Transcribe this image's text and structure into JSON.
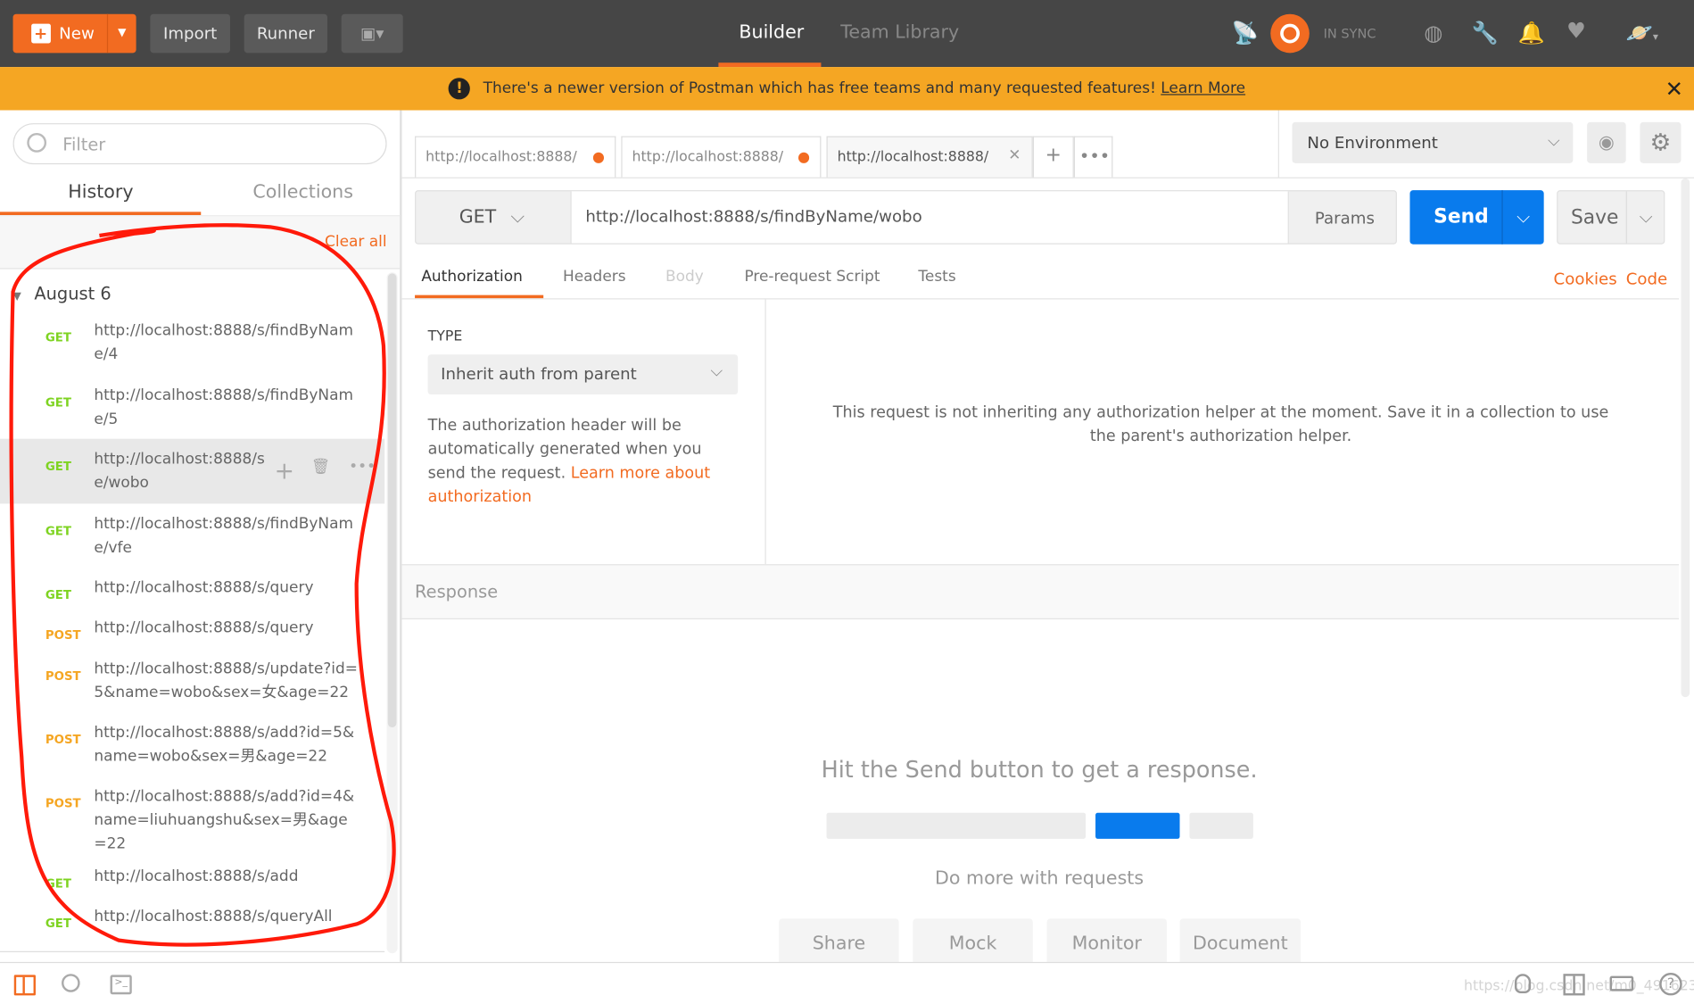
{
  "topbar": {
    "new_label": "New",
    "import_label": "Import",
    "runner_label": "Runner",
    "tabs": [
      "Builder",
      "Team Library"
    ],
    "active_tab": "Builder",
    "sync_status": "IN SYNC",
    "accent": "#f26b21"
  },
  "banner": {
    "message": "There's a newer version of Postman which has free teams and many requested features!",
    "link": "Learn More",
    "color": "#f5a623"
  },
  "sidebar": {
    "filter_placeholder": "Filter",
    "tabs": [
      "History",
      "Collections"
    ],
    "active_tab": "History",
    "clear_all": "Clear all",
    "group": "August 6",
    "items": [
      {
        "method": "GET",
        "url": "http://localhost:8888/s/findByName/4"
      },
      {
        "method": "GET",
        "url": "http://localhost:8888/s/findByName/5"
      },
      {
        "method": "GET",
        "url": "http://localhost:8888/s/findByName/wobo",
        "display": "http://localhost:8888/s/ e/wobo",
        "hovered": true
      },
      {
        "method": "GET",
        "url": "http://localhost:8888/s/findByName/vfe"
      },
      {
        "method": "GET",
        "url": "http://localhost:8888/s/query"
      },
      {
        "method": "POST",
        "url": "http://localhost:8888/s/query"
      },
      {
        "method": "POST",
        "url": "http://localhost:8888/s/update?id=5&name=wobo&sex=女&age=22"
      },
      {
        "method": "POST",
        "url": "http://localhost:8888/s/add?id=5&name=wobo&sex=男&age=22"
      },
      {
        "method": "POST",
        "url": "http://localhost:8888/s/add?id=4&name=liuhuangshu&sex=男&age=22"
      },
      {
        "method": "GET",
        "url": "http://localhost:8888/s/add"
      },
      {
        "method": "GET",
        "url": "http://localhost:8888/s/queryAll"
      }
    ],
    "method_colors": {
      "GET": "#7ed321",
      "POST": "#f5a623"
    }
  },
  "request_tabs": [
    {
      "label": "http://localhost:8888/s",
      "unsaved": true
    },
    {
      "label": "http://localhost:8888/s",
      "unsaved": true
    },
    {
      "label": "http://localhost:8888/s",
      "active": true
    }
  ],
  "environment": {
    "selected": "No Environment"
  },
  "request": {
    "method": "GET",
    "url": "http://localhost:8888/s/findByName/wobo",
    "params": "Params",
    "send": "Send",
    "save": "Save"
  },
  "subtabs": [
    "Authorization",
    "Headers",
    "Body",
    "Pre-request Script",
    "Tests"
  ],
  "active_subtab": "Authorization",
  "links": {
    "cookies": "Cookies",
    "code": "Code"
  },
  "auth": {
    "type_label": "TYPE",
    "type_value": "Inherit auth from parent",
    "description": "The authorization header will be automatically generated when you send the request. ",
    "learn_more": "Learn more about authorization",
    "message": "This request is not inheriting any authorization helper at the moment. Save it in a collection to use the parent's authorization helper."
  },
  "response": {
    "title": "Response",
    "empty_message": "Hit the Send button to get a response.",
    "do_more": "Do more with requests",
    "actions": [
      "Share",
      "Mock",
      "Monitor",
      "Document"
    ]
  },
  "watermark": "https://blog.csdn.net/m0_49162372"
}
